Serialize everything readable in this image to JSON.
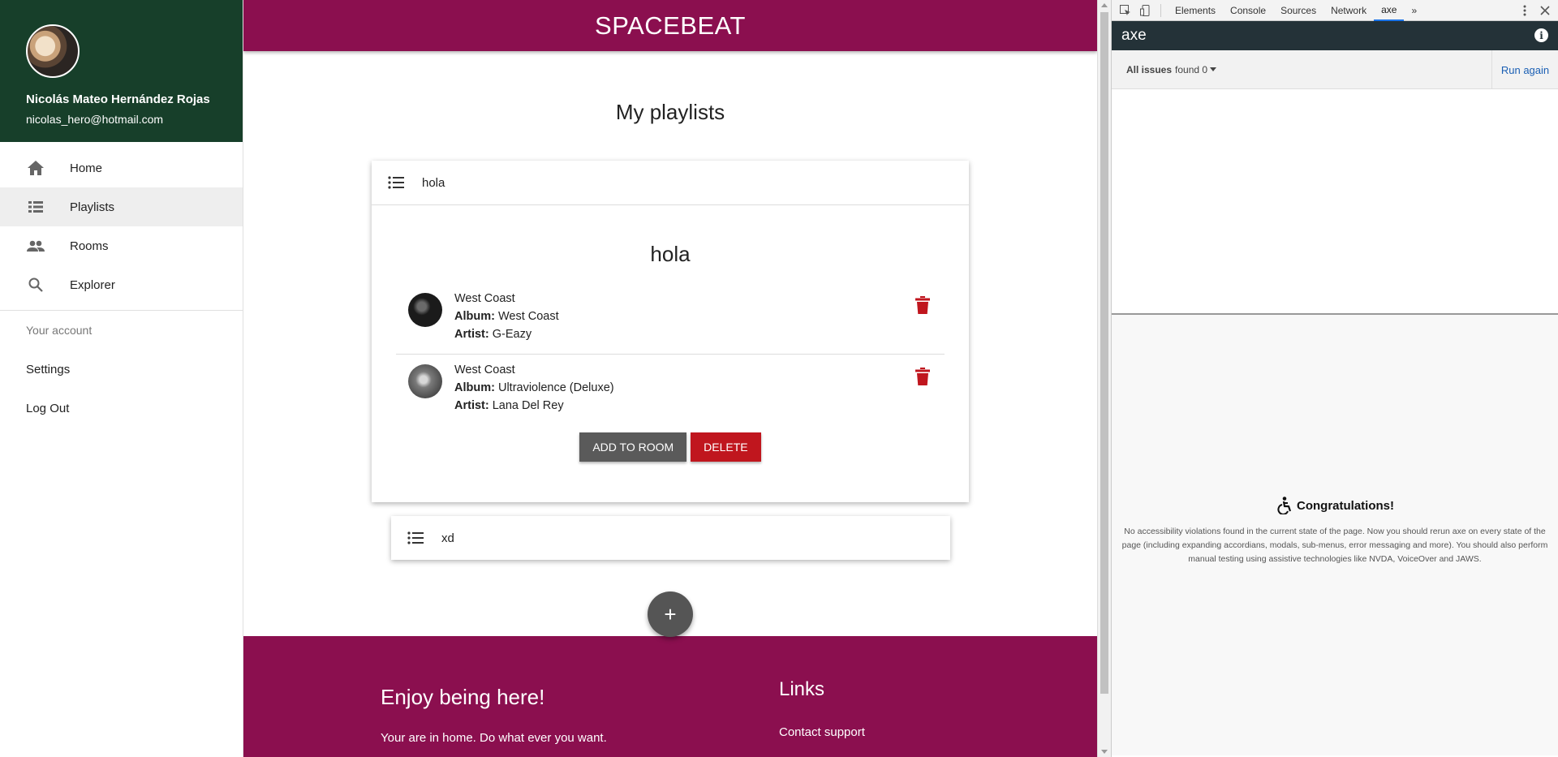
{
  "sidebar": {
    "user_name": "Nicolás Mateo Hernández Rojas",
    "user_email": "nicolas_hero@hotmail.com",
    "nav": [
      {
        "label": "Home",
        "icon": "home-icon"
      },
      {
        "label": "Playlists",
        "icon": "list-icon"
      },
      {
        "label": "Rooms",
        "icon": "people-icon"
      },
      {
        "label": "Explorer",
        "icon": "search-icon"
      }
    ],
    "account_label": "Your account",
    "settings_label": "Settings",
    "logout_label": "Log Out"
  },
  "header": {
    "title": "SPACEBEAT"
  },
  "main": {
    "heading": "My playlists",
    "playlists": [
      {
        "name": "hola",
        "title": "hola",
        "tracks": [
          {
            "title": "West Coast",
            "album_label": "Album:",
            "album": "West Coast",
            "artist_label": "Artist:",
            "artist": "G-Eazy"
          },
          {
            "title": "West Coast",
            "album_label": "Album:",
            "album": "Ultraviolence (Deluxe)",
            "artist_label": "Artist:",
            "artist": "Lana Del Rey"
          }
        ],
        "add_to_room_label": "ADD TO ROOM",
        "delete_label": "DELETE"
      },
      {
        "name": "xd"
      }
    ],
    "fab_label": "+"
  },
  "footer": {
    "title": "Enjoy being here!",
    "text": "Your are in home. Do what ever you want.",
    "links_title": "Links",
    "contact_support": "Contact support"
  },
  "devtools": {
    "tabs": [
      "Elements",
      "Console",
      "Sources",
      "Network",
      "axe"
    ],
    "active_tab": "axe",
    "overflow": "»",
    "axe": {
      "title": "axe",
      "issues_label": "All issues",
      "issues_found": "found 0",
      "run_again": "Run again",
      "congrats_title": "Congratulations!",
      "congrats_text": "No accessibility violations found in the current state of the page. Now you should rerun axe on every state of the page (including expanding accordians, modals, sub-menus, error messaging and more). You should also perform manual testing using assistive technologies like NVDA, VoiceOver and JAWS."
    }
  },
  "colors": {
    "header": "#8b0f4f",
    "sidebar_header": "#173f2a",
    "delete": "#c0161e",
    "button_grey": "#5a5a5a"
  }
}
